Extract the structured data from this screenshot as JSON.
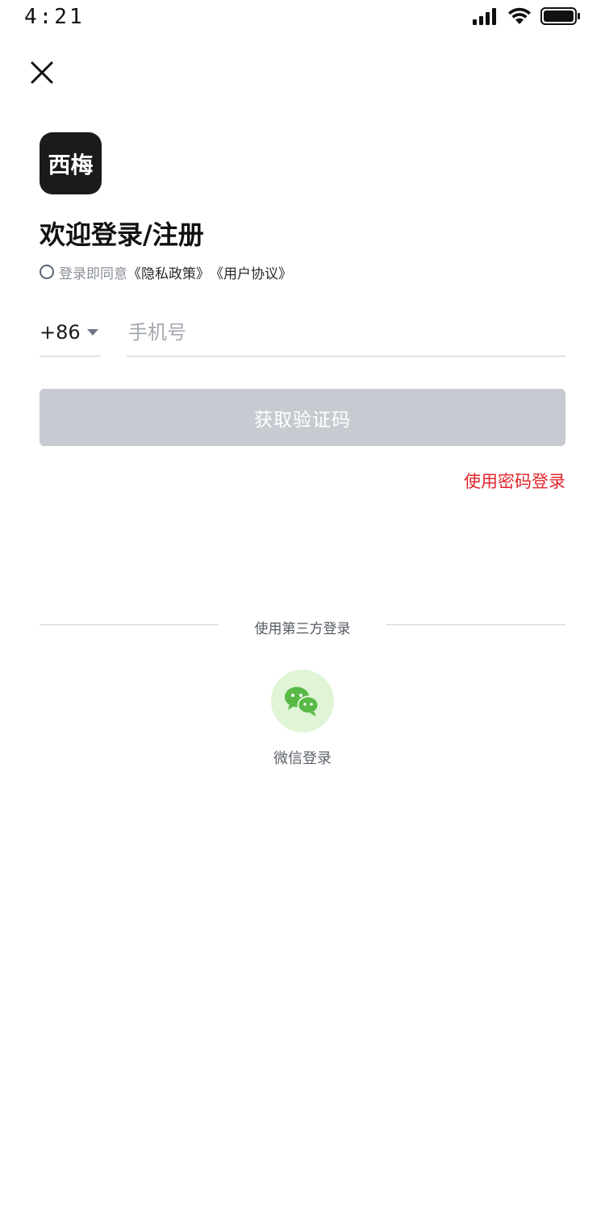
{
  "status_bar": {
    "time": "4:21"
  },
  "logo": {
    "text": "西梅"
  },
  "title": "欢迎登录/注册",
  "agreement": {
    "prefix": "登录即同意",
    "privacy_link": "《隐私政策》",
    "user_link": "《用户协议》"
  },
  "phone": {
    "country_code": "+86",
    "placeholder": "手机号",
    "value": ""
  },
  "code_button": {
    "label": "获取验证码"
  },
  "password_login": {
    "label": "使用密码登录"
  },
  "third_party": {
    "heading": "使用第三方登录",
    "wechat_label": "微信登录"
  },
  "colors": {
    "accent_red": "#e0262c",
    "button_disabled": "#c7cbd1",
    "wechat_green": "#58b947",
    "wechat_bg": "#dff5d6"
  },
  "icons": {
    "close": "close-icon",
    "signal": "cellular-signal-icon",
    "wifi": "wifi-icon",
    "battery": "battery-icon",
    "wechat": "wechat-icon",
    "caret": "caret-down-icon"
  }
}
